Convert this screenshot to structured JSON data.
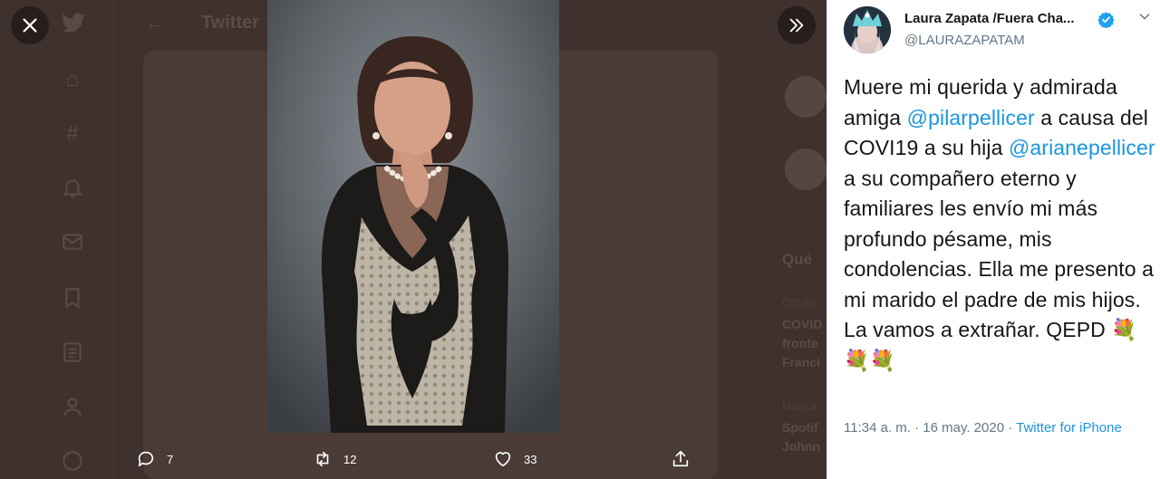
{
  "background": {
    "header_title": "Twitter",
    "side_heading": "Qué",
    "side_items": [
      {
        "category": "COVID",
        "line1": "COVID",
        "line2": "fronte",
        "line3": "Franci"
      },
      {
        "category": "Música",
        "line1": "Spotif",
        "line2": "Johnn"
      }
    ]
  },
  "overlay": {
    "close_icon": "close-icon",
    "expand_icon": "double-chevron-right-icon"
  },
  "actions": {
    "reply_count": "7",
    "retweet_count": "12",
    "like_count": "33"
  },
  "tweet": {
    "author_name": "Laura Zapata /Fuera Cha...",
    "author_handle": "@LAURAZAPATAM",
    "text_part1": "Muere mi querida y admirada amiga ",
    "mention1": "@pilarpellicer",
    "text_part2": " a causa del COVI19 a su hija ",
    "mention2": "@arianepellicer",
    "text_part3": " a su compañero eterno y familiares les envío mi más profundo pésame, mis condolencias. Ella me presento a mi marido el padre de mis hijos. La vamos a extrañar. QEPD ",
    "emoji": "💐💐💐",
    "timestamp": "11:34 a. m. · 16 may. 2020",
    "separator": " · ",
    "source": "Twitter for iPhone"
  },
  "colors": {
    "accent": "#1b95e0",
    "verified": "#1da1f2",
    "backdrop": "#3e312e",
    "muted_text": "#657786"
  }
}
